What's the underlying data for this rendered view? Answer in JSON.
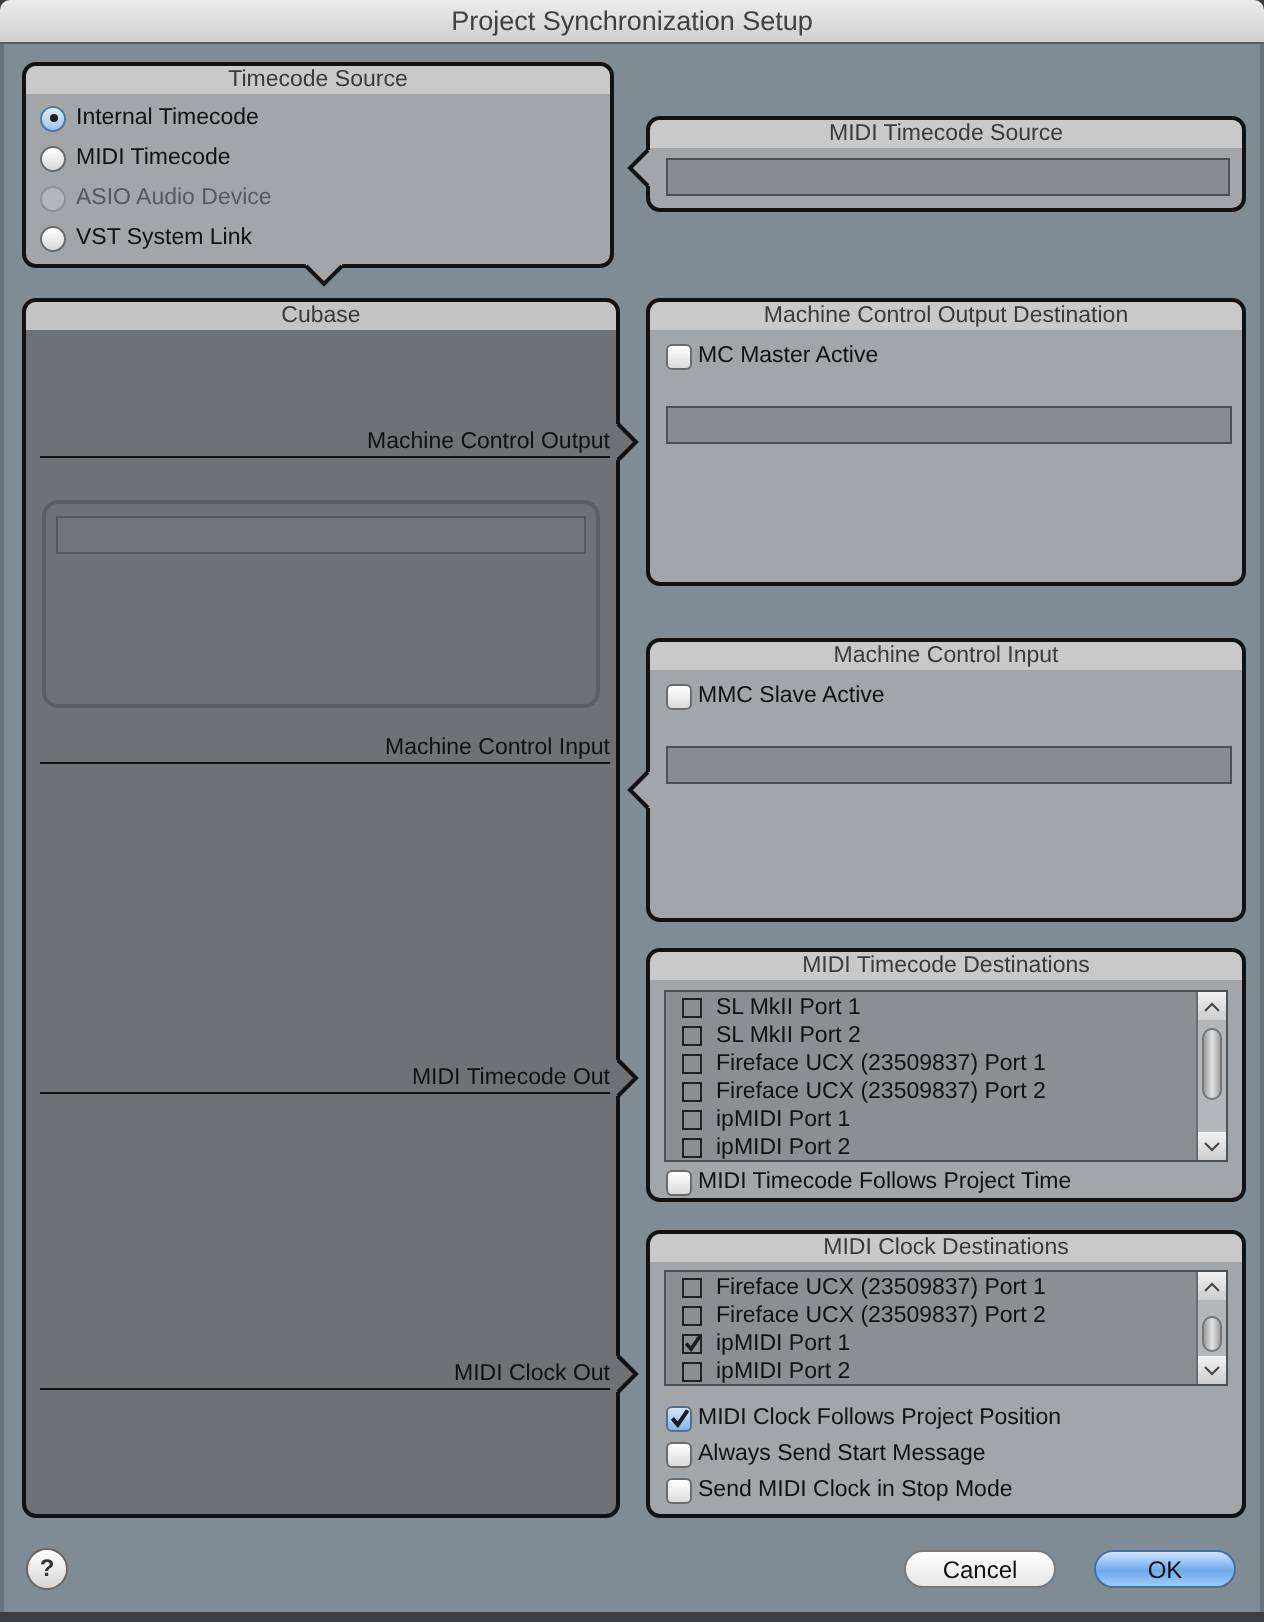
{
  "window": {
    "title": "Project Synchronization Setup"
  },
  "timecode_source": {
    "title": "Timecode Source",
    "options": [
      {
        "label": "Internal Timecode",
        "selected": true,
        "disabled": false
      },
      {
        "label": "MIDI Timecode",
        "selected": false,
        "disabled": false
      },
      {
        "label": "ASIO Audio Device",
        "selected": false,
        "disabled": true
      },
      {
        "label": "VST System Link",
        "selected": false,
        "disabled": false
      }
    ]
  },
  "midi_timecode_source": {
    "title": "MIDI Timecode Source"
  },
  "cubase": {
    "title": "Cubase",
    "ports": [
      {
        "label": "Machine Control Output"
      },
      {
        "label": "Machine Control Input"
      },
      {
        "label": "MIDI Timecode Out"
      },
      {
        "label": "MIDI Clock Out"
      }
    ]
  },
  "machine_control_output_destination": {
    "title": "Machine Control Output Destination",
    "option": {
      "label": "MC Master Active",
      "checked": false
    }
  },
  "machine_control_input": {
    "title": "Machine Control Input",
    "option": {
      "label": "MMC Slave Active",
      "checked": false
    }
  },
  "midi_timecode_destinations": {
    "title": "MIDI Timecode Destinations",
    "ports": [
      {
        "label": "SL MkII Port 1",
        "checked": false
      },
      {
        "label": "SL MkII Port 2",
        "checked": false
      },
      {
        "label": "Fireface UCX (23509837) Port 1",
        "checked": false
      },
      {
        "label": "Fireface UCX (23509837) Port 2",
        "checked": false
      },
      {
        "label": "ipMIDI Port 1",
        "checked": false
      },
      {
        "label": "ipMIDI Port 2",
        "checked": false
      }
    ],
    "option": {
      "label": "MIDI Timecode Follows Project Time",
      "checked": false
    }
  },
  "midi_clock_destinations": {
    "title": "MIDI Clock Destinations",
    "ports": [
      {
        "label": "Fireface UCX (23509837) Port 1",
        "checked": false
      },
      {
        "label": "Fireface UCX (23509837) Port 2",
        "checked": false
      },
      {
        "label": "ipMIDI Port 1",
        "checked": true
      },
      {
        "label": "ipMIDI Port 2",
        "checked": false
      }
    ],
    "options": [
      {
        "label": "MIDI Clock Follows Project Position",
        "checked": true
      },
      {
        "label": "Always Send Start Message",
        "checked": false
      },
      {
        "label": "Send MIDI Clock in Stop Mode",
        "checked": false
      }
    ]
  },
  "footer": {
    "help": "?",
    "buttons": [
      {
        "label": "Cancel",
        "default": false
      },
      {
        "label": "OK",
        "default": true
      }
    ]
  }
}
